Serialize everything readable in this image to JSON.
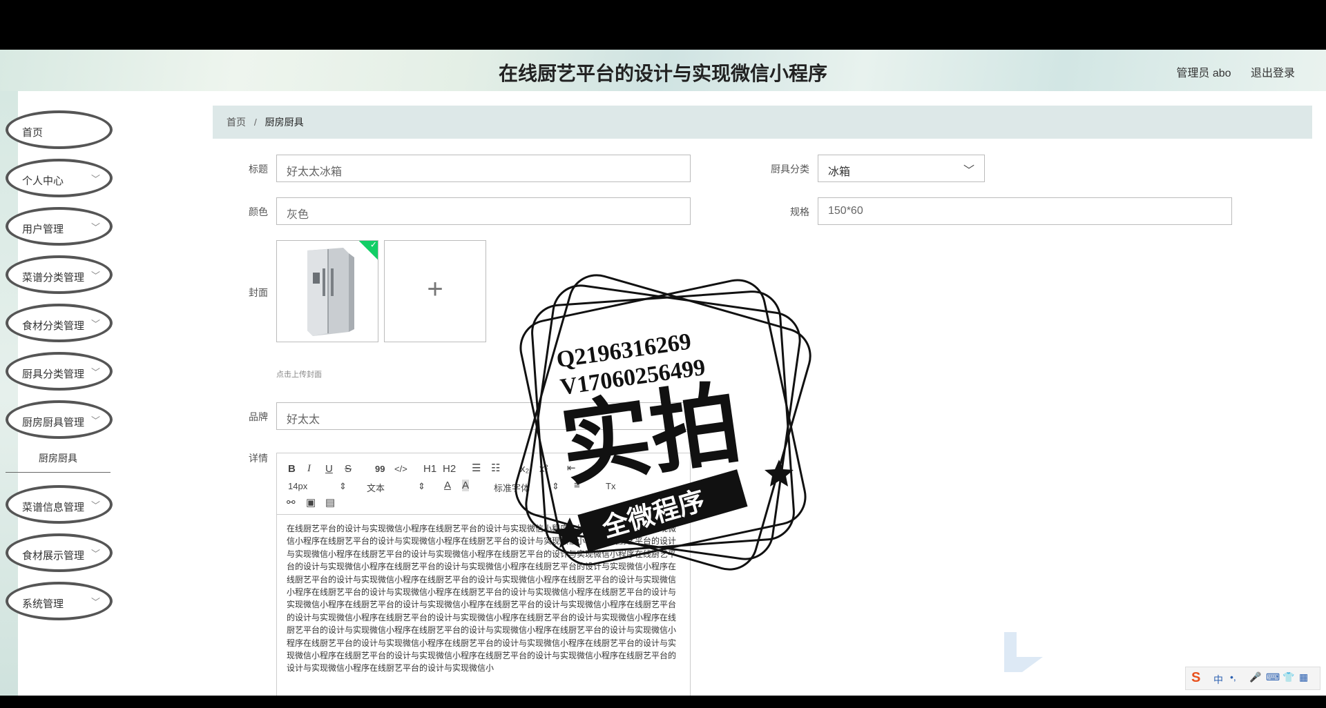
{
  "header": {
    "title": "在线厨艺平台的设计与实现微信小程序",
    "user_label": "管理员 abo",
    "logout_label": "退出登录"
  },
  "sidebar": {
    "items": [
      {
        "label": "首页",
        "has_chevron": false
      },
      {
        "label": "个人中心",
        "has_chevron": true
      },
      {
        "label": "用户管理",
        "has_chevron": true
      },
      {
        "label": "菜谱分类管理",
        "has_chevron": true
      },
      {
        "label": "食材分类管理",
        "has_chevron": true
      },
      {
        "label": "厨具分类管理",
        "has_chevron": true
      },
      {
        "label": "厨房厨具管理",
        "has_chevron": true
      },
      {
        "label": "菜谱信息管理",
        "has_chevron": true
      },
      {
        "label": "食材展示管理",
        "has_chevron": true
      },
      {
        "label": "系统管理",
        "has_chevron": true
      }
    ],
    "sub_item": "厨房厨具"
  },
  "breadcrumb": {
    "home": "首页",
    "separator": "/",
    "current": "厨房厨具"
  },
  "form": {
    "title_label": "标题",
    "title_value": "好太太冰箱",
    "category_label": "厨具分类",
    "category_value": "冰箱",
    "color_label": "颜色",
    "color_value": "灰色",
    "spec_label": "规格",
    "spec_value": "150*60",
    "cover_label": "封面",
    "upload_hint": "点击上传封面",
    "upload_add": "+",
    "brand_label": "品牌",
    "brand_value": "好太太",
    "detail_label": "详情"
  },
  "editor": {
    "toolbar": {
      "bold": "B",
      "italic": "I",
      "underline": "U",
      "strike": "S",
      "quote": "99",
      "code": "</>",
      "h1": "H1",
      "h2": "H2",
      "sub": "x₂",
      "sup": "x²",
      "font_size": "14px",
      "text_style": "文本",
      "font_family": "标准字体"
    },
    "content": "在线厨艺平台的设计与实现微信小程序在线厨艺平台的设计与实现微信小程序在线厨艺平台的设计与实现微信小程序在线厨艺平台的设计与实现微信小程序在线厨艺平台的设计与实现微信小程序在线厨艺平台的设计与实现微信小程序在线厨艺平台的设计与实现微信小程序在线厨艺平台的设计与实现微信小程序在线厨艺平台的设计与实现微信小程序在线厨艺平台的设计与实现微信小程序在线厨艺平台的设计与实现微信小程序在线厨艺平台的设计与实现微信小程序在线厨艺平台的设计与实现微信小程序在线厨艺平台的设计与实现微信小程序在线厨艺平台的设计与实现微信小程序在线厨艺平台的设计与实现微信小程序在线厨艺平台的设计与实现微信小程序在线厨艺平台的设计与实现微信小程序在线厨艺平台的设计与实现微信小程序在线厨艺平台的设计与实现微信小程序在线厨艺平台的设计与实现微信小程序在线厨艺平台的设计与实现微信小程序在线厨艺平台的设计与实现微信小程序在线厨艺平台的设计与实现微信小程序在线厨艺平台的设计与实现微信小程序在线厨艺平台的设计与实现微信小程序在线厨艺平台的设计与实现微信小程序在线厨艺平台的设计与实现微信小程序在线厨艺平台的设计与实现微信小程序在线厨艺平台的设计与实现微信小程序在线厨艺平台的设计与实现微信小程序在线厨艺平台的设计与实现微信小"
  },
  "watermark": {
    "line1": "Q2196316269",
    "line2": "V17060256499",
    "big": "实拍",
    "banner": "全微程序"
  },
  "ime": {
    "lang": "中"
  }
}
